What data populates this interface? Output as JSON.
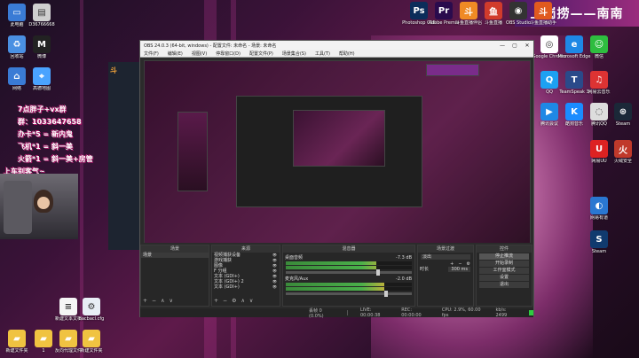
{
  "desktop": {
    "banner": "上岗捞——南南",
    "overlay_lines": [
      "7点胖子+vx群",
      "群：1033647658",
      "办卡*5 = 新内鬼",
      "飞机*1 = 斜一美",
      "火箭*1 = 斜一美+房管",
      "上车别客气~"
    ],
    "icons_left": [
      {
        "label": "此电脑",
        "color": "#3a7bd5",
        "glyph": "▭"
      },
      {
        "label": "D36766668",
        "color": "#cfcfcf",
        "glyph": "▤"
      },
      {
        "label": "微博",
        "color": "#222",
        "glyph": "M"
      },
      {
        "label": "回收站",
        "color": "#4a90e2",
        "glyph": "♻"
      },
      {
        "label": "高德地图",
        "color": "#4aa3ff",
        "glyph": "⌖"
      },
      {
        "label": "网络",
        "color": "#3a7bd5",
        "glyph": "⌂"
      }
    ],
    "icons_top": [
      {
        "label": "Photoshop CS6",
        "color": "#0b2d5a",
        "glyph": "Ps"
      },
      {
        "label": "Adobe Premie",
        "color": "#2a0b4d",
        "glyph": "Pr"
      },
      {
        "label": "斗鱼直播伴侣",
        "color": "#f08a24",
        "glyph": "斗"
      },
      {
        "label": "斗鱼直播",
        "color": "#d13b2c",
        "glyph": "鱼"
      },
      {
        "label": "OBS Studio",
        "color": "#333",
        "glyph": "◉"
      },
      {
        "label": "斗鱼直播助手",
        "color": "#e05a1f",
        "glyph": "斗"
      }
    ],
    "icons_right": [
      {
        "label": "Google Chrome",
        "color": "#ffffff",
        "glyph": "◎"
      },
      {
        "label": "Microsoft Edge",
        "color": "#1e88e5",
        "glyph": "e"
      },
      {
        "label": "微信",
        "color": "#2ebd3f",
        "glyph": "☺"
      },
      {
        "label": "QQ",
        "color": "#1da1f2",
        "glyph": "Q"
      },
      {
        "label": "TeamSpeak 3",
        "color": "#2a4a8a",
        "glyph": "T"
      },
      {
        "label": "网易云音乐",
        "color": "#d33",
        "glyph": "♫"
      },
      {
        "label": "腾讯会议",
        "color": "#1e88e5",
        "glyph": "▶"
      },
      {
        "label": "酷狗音乐",
        "color": "#1a8cff",
        "glyph": "K"
      },
      {
        "label": "腾讯QQ",
        "color": "#ddd",
        "glyph": "◌"
      },
      {
        "label": "Steam",
        "color": "#1b2838",
        "glyph": "⊛"
      },
      {
        "label": "网易UU",
        "color": "#d22",
        "glyph": "U"
      },
      {
        "label": "火绒安全",
        "color": "#c0392b",
        "glyph": "火"
      },
      {
        "label": "网易有道",
        "color": "#2a77d1",
        "glyph": "◐"
      },
      {
        "label": "Steam",
        "color": "#103a6e",
        "glyph": "S"
      }
    ],
    "icons_bottom": [
      {
        "label": "新建文本文档",
        "color": "#f5f5f5",
        "glyph": "≡"
      },
      {
        "label": "bacbacl.cfg",
        "color": "#e8eef5",
        "glyph": "⚙"
      },
      {
        "label": "新建文件夹",
        "color": "#f0c341",
        "glyph": "▰"
      },
      {
        "label": "1",
        "color": "#f0c341",
        "glyph": "▰"
      },
      {
        "label": "反向代理文件",
        "color": "#f0c341",
        "glyph": "▰"
      },
      {
        "label": "新建文件夹",
        "color": "#f0c341",
        "glyph": "▰"
      }
    ]
  },
  "obs": {
    "title": "OBS 24.0.3 (64-bit, windows) - 配置文件: 未命名 - 场景: 未命名",
    "window_controls": [
      "—",
      "▢",
      "✕"
    ],
    "menu": [
      "文件(F)",
      "编辑(E)",
      "视图(V)",
      "停靠窗口(D)",
      "配置文件(P)",
      "场景集合(S)",
      "工具(T)",
      "帮助(H)"
    ],
    "docks": {
      "scenes": {
        "title": "场景",
        "items": [
          "场景"
        ],
        "tools": [
          "+",
          "−",
          "∧",
          "∨"
        ]
      },
      "sources": {
        "title": "来源",
        "items": [
          "视频捕获设备",
          "游戏捕获",
          "图像",
          "F 分组",
          "文本 (GDI+)",
          "文本 (GDI+) 2",
          "文本 (GDI+)"
        ],
        "tools": [
          "+",
          "−",
          "⚙",
          "∧",
          "∨"
        ]
      },
      "mixer": {
        "title": "混音器",
        "channels": [
          {
            "name": "桌面音频",
            "db": "-7.3 dB",
            "level": 0.72
          },
          {
            "name": "麦克风/Aux",
            "db": "-2.0 dB",
            "level": 0.78
          }
        ]
      },
      "transitions": {
        "title": "场景过渡",
        "type": "淡出",
        "duration_label": "时长",
        "duration": "300 ms",
        "tools": [
          "+",
          "−",
          "⚙"
        ]
      },
      "controls": {
        "title": "控件",
        "buttons": [
          "停止推流",
          "开始录制",
          "工作室模式",
          "设置",
          "退出"
        ]
      }
    },
    "status": {
      "dropped": "丢帧 0 (0.0%)",
      "live": "LIVE: 00:00:38",
      "rec": "REC: 00:00:00",
      "cpu": "CPU: 2.9%, 60.00 fps",
      "kbps": "kb/s: 2499"
    }
  }
}
